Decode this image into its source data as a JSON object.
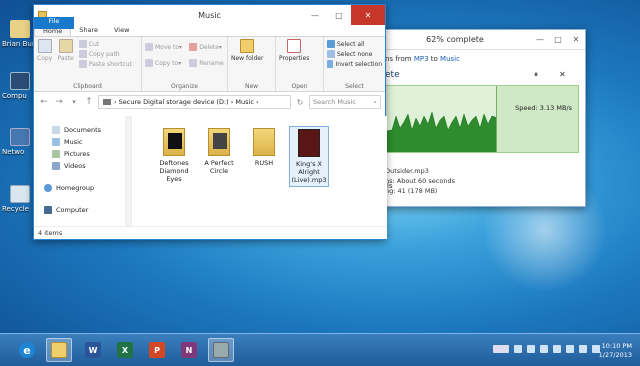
{
  "desktop": {
    "icons": [
      {
        "label": "Brian Bur"
      },
      {
        "label": "Compu"
      },
      {
        "label": "Netwo"
      },
      {
        "label": "Recycle"
      }
    ]
  },
  "copy_dialog": {
    "title": "62% complete",
    "progress_percent": 62,
    "line_prefix": "ns from ",
    "source": "MP3",
    "line_mid": " to ",
    "dest": "Music",
    "heading": "ete",
    "pause_icon": "⏸",
    "stop_icon": "✕",
    "speed": "Speed: 3.13 MB/s",
    "name": "Outsider.mp3",
    "time_left": "ns: About 60 seconds",
    "items_left": "ng: 41 (178 MB)",
    "fewer_details": "ils",
    "min_label": "—",
    "max_label": "□",
    "close_label": "✕"
  },
  "explorer": {
    "title": "Music",
    "min_label": "—",
    "max_label": "□",
    "close_label": "✕",
    "tabs": [
      "File",
      "Home",
      "Share",
      "View"
    ],
    "ribbon": {
      "clipboard": {
        "copy": "Copy",
        "paste": "Paste",
        "cut": "Cut",
        "copy_path": "Copy path",
        "paste_shortcut": "Paste shortcut",
        "caption": "Clipboard"
      },
      "organize": {
        "move_to": "Move to",
        "copy_to": "Copy to",
        "delete": "Delete",
        "rename": "Rename",
        "caption": "Organize"
      },
      "new": {
        "new_folder": "New folder",
        "caption": "New"
      },
      "open": {
        "properties": "Properties",
        "caption": "Open"
      },
      "select": {
        "select_all": "Select all",
        "select_none": "Select none",
        "invert": "Invert selection",
        "caption": "Select"
      }
    },
    "address": {
      "path_parts": [
        "Secure Digital storage device (D:)",
        "Music"
      ],
      "search_placeholder": "Search Music"
    },
    "nav": [
      {
        "label": "Documents"
      },
      {
        "label": "Music"
      },
      {
        "label": "Pictures"
      },
      {
        "label": "Videos"
      },
      {
        "label": "Homegroup"
      },
      {
        "label": "Computer"
      }
    ],
    "files": [
      {
        "name": "Deftones Diamond Eyes"
      },
      {
        "name": "A Perfect Circle"
      },
      {
        "name": "RUSH"
      },
      {
        "name": "King's X Alright (Live).mp3"
      }
    ],
    "status": "4 items"
  },
  "taskbar": {
    "apps": [
      {
        "icon": "internet-explorer-icon",
        "label": "e"
      },
      {
        "icon": "file-explorer-icon",
        "label": ""
      },
      {
        "icon": "word-icon",
        "label": "W"
      },
      {
        "icon": "excel-icon",
        "label": "X"
      },
      {
        "icon": "powerpoint-icon",
        "label": "P"
      },
      {
        "icon": "onenote-icon",
        "label": "N"
      },
      {
        "icon": "copy-progress-icon",
        "label": ""
      }
    ],
    "time": "10:10 PM",
    "date": "1/27/2013"
  }
}
